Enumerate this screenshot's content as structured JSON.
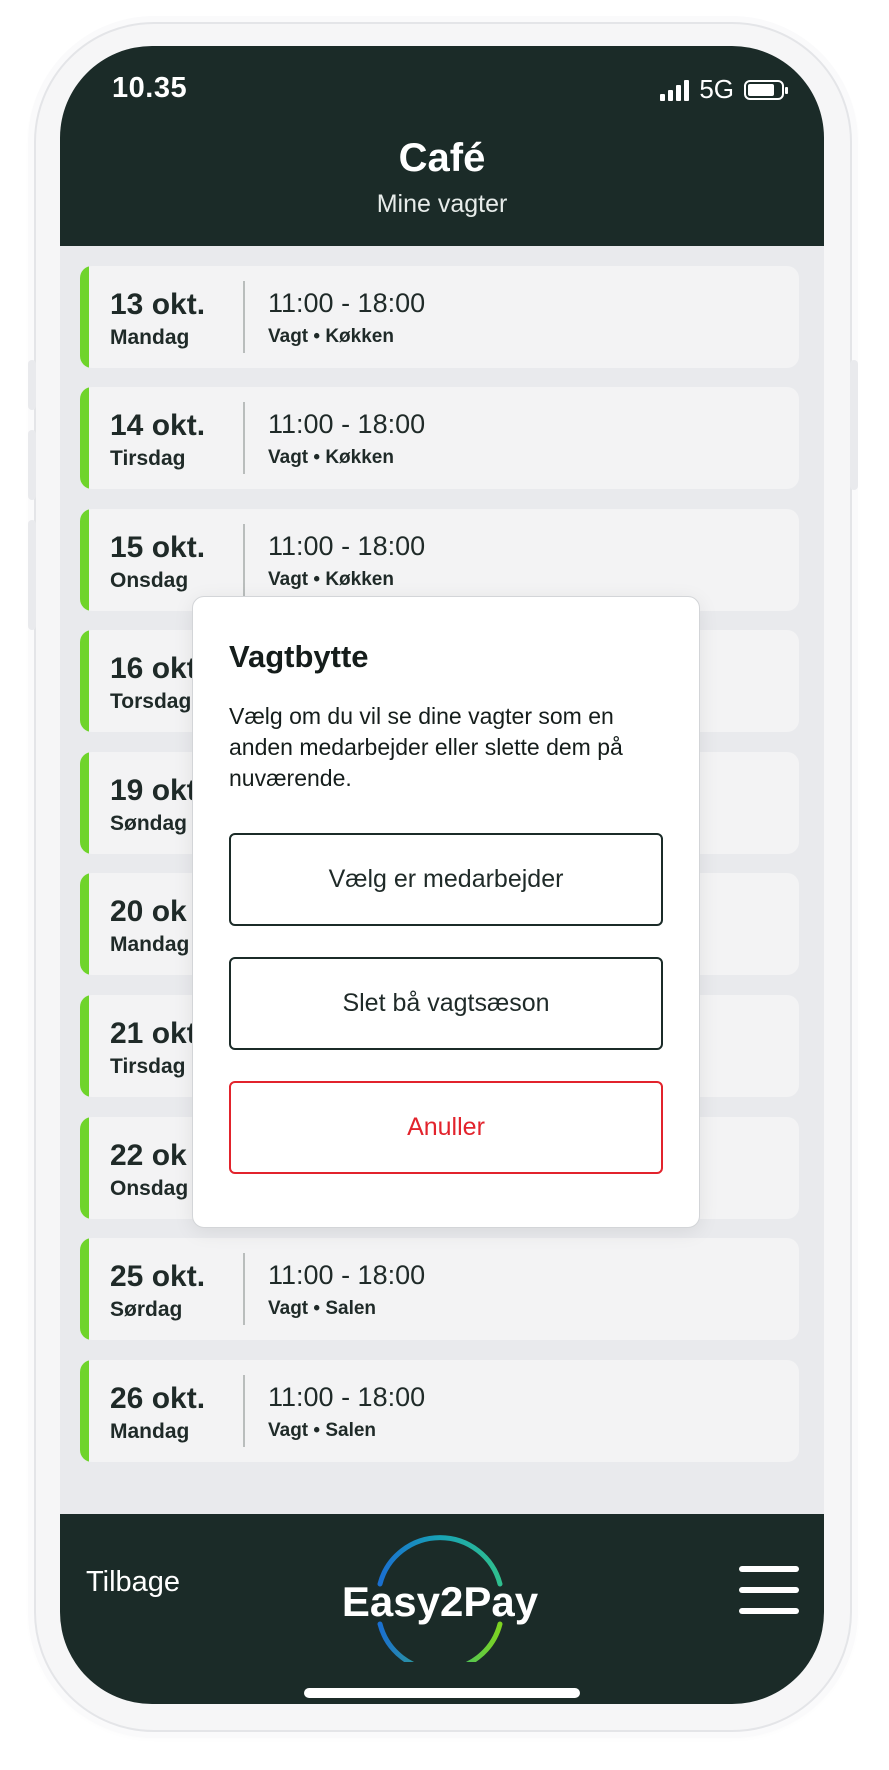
{
  "status_bar": {
    "time": "10.35",
    "network": "5G"
  },
  "header": {
    "title": "Café",
    "subtitle": "Mine vagter"
  },
  "shifts": [
    {
      "date": "13 okt.",
      "weekday": "Mandag",
      "time": "11:00 - 18:00",
      "detail": "Vagt • Køkken"
    },
    {
      "date": "14 okt.",
      "weekday": "Tirsdag",
      "time": "11:00 - 18:00",
      "detail": "Vagt • Køkken"
    },
    {
      "date": "15 okt.",
      "weekday": "Onsdag",
      "time": "11:00 - 18:00",
      "detail": "Vagt • Køkken"
    },
    {
      "date": "16 okt",
      "weekday": "Torsdag"
    },
    {
      "date": "19 okt",
      "weekday": "Søndag"
    },
    {
      "date": "20 ok",
      "weekday": "Mandag"
    },
    {
      "date": "21 okt",
      "weekday": "Tirsdag"
    },
    {
      "date": "22 ok",
      "weekday": "Onsdag"
    },
    {
      "date": "25 okt.",
      "weekday": "Sørdag",
      "time": "11:00 - 18:00",
      "detail": "Vagt • Salen"
    },
    {
      "date": "26 okt.",
      "weekday": "Mandag",
      "time": "11:00 - 18:00",
      "detail": "Vagt • Salen"
    }
  ],
  "dialog": {
    "title": "Vagtbytte",
    "message": "Vælg om du vil se dine vagter som en anden medarbejder eller slette dem på nuværende.",
    "buttons": {
      "choose_employee": "Vælg er medarbejder",
      "delete_season": "Slet bå vagtsæson",
      "cancel": "Anuller"
    }
  },
  "footer": {
    "back_label": "Tilbage",
    "logo_text": "Easy2Pay"
  },
  "colors": {
    "dark": "#1b2b28",
    "accent": "#6fd42b",
    "danger": "#e2232c"
  }
}
